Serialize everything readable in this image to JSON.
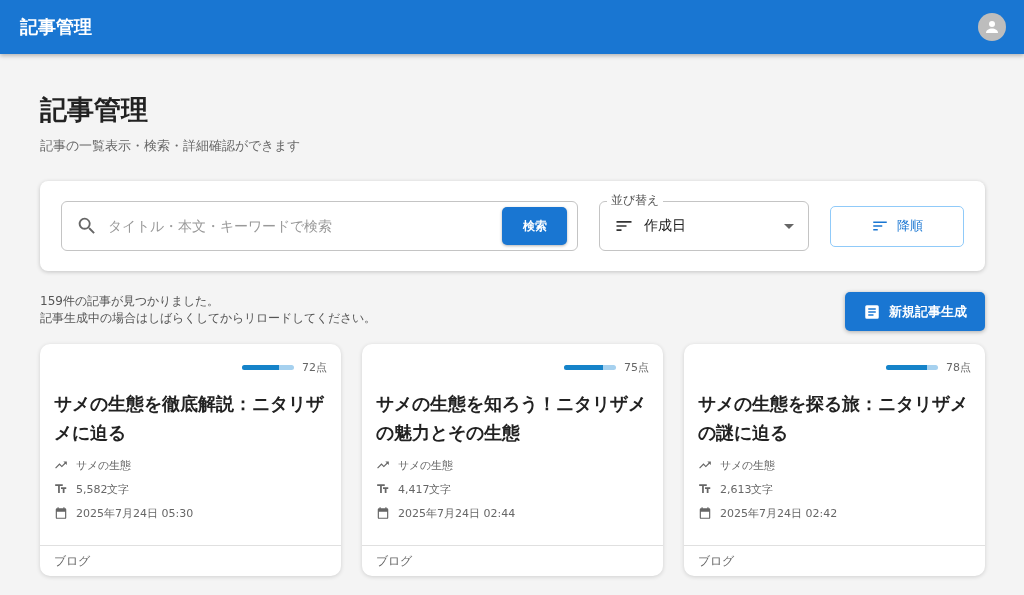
{
  "app_bar": {
    "title": "記事管理"
  },
  "page": {
    "title": "記事管理",
    "subtitle": "記事の一覧表示・検索・詳細確認ができます"
  },
  "search": {
    "placeholder": "タイトル・本文・キーワードで検索",
    "button": "検索"
  },
  "sort": {
    "label": "並び替え",
    "value": "作成日",
    "order_button": "降順"
  },
  "results": {
    "count_text": "159件の記事が見つかりました。",
    "note": "記事生成中の場合はしばらくしてからリロードしてください。"
  },
  "new_button": "新規記事生成",
  "articles": [
    {
      "score": "72点",
      "level": 0.72,
      "title": "サメの生態を徹底解説：ニタリザメに迫る",
      "keyword": "サメの生態",
      "chars": "5,582文字",
      "date": "2025年7月24日 05:30",
      "type": "ブログ"
    },
    {
      "score": "75点",
      "level": 0.75,
      "title": "サメの生態を知ろう！ニタリザメの魅力とその生態",
      "keyword": "サメの生態",
      "chars": "4,417文字",
      "date": "2025年7月24日 02:44",
      "type": "ブログ"
    },
    {
      "score": "78点",
      "level": 0.78,
      "title": "サメの生態を探る旅：ニタリザメの謎に迫る",
      "keyword": "サメの生態",
      "chars": "2,613文字",
      "date": "2025年7月24日 02:42",
      "type": "ブログ"
    }
  ]
}
